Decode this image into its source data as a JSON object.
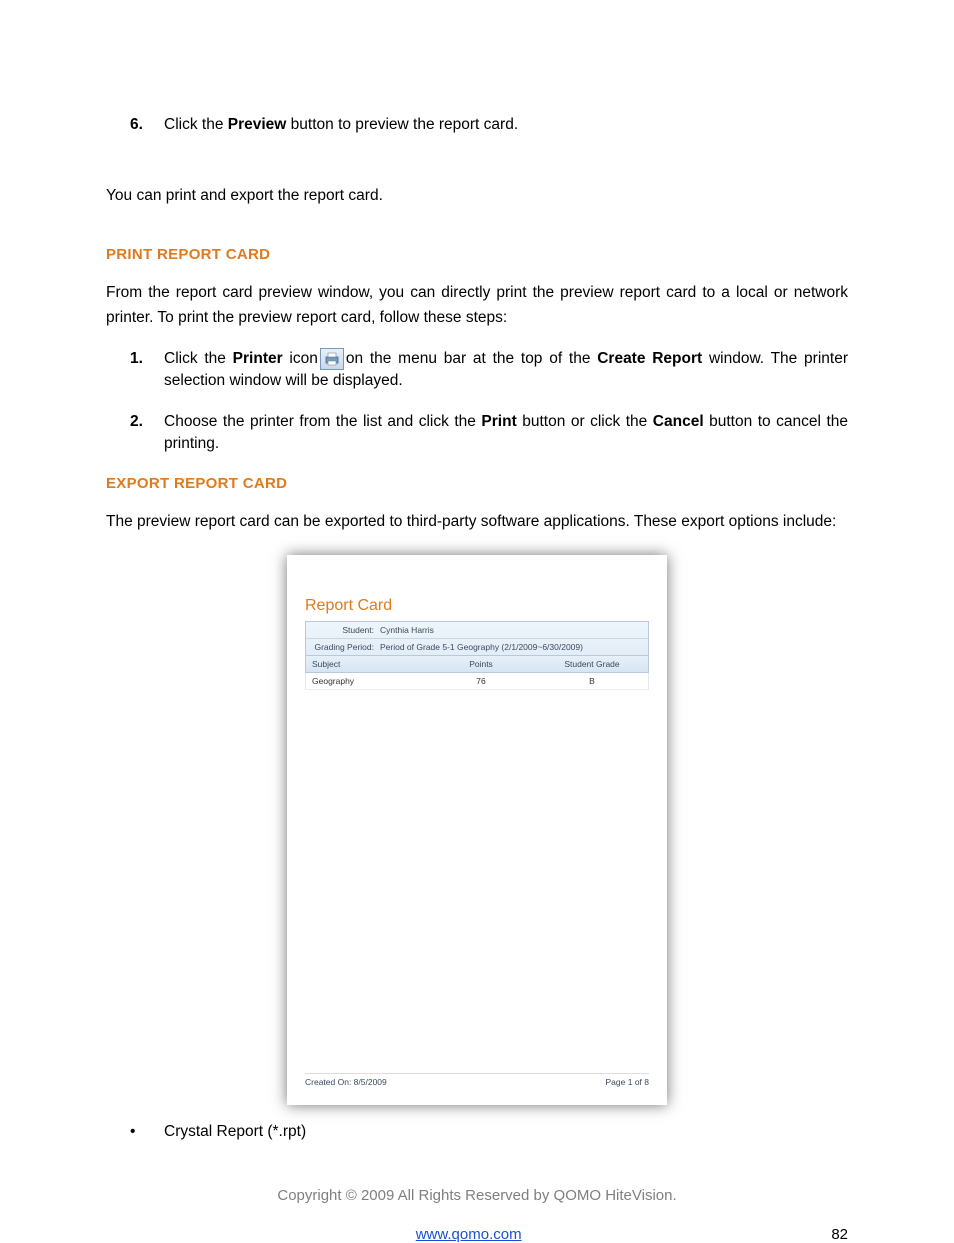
{
  "step6": {
    "num": "6.",
    "text_pre": "Click the ",
    "bold1": "Preview",
    "text_post": " button to preview the report card."
  },
  "intro_after": "You can print and export the report card.",
  "print_heading": "PRINT REPORT CARD",
  "print_intro": "From the report card preview window, you can directly print the preview report card to a local or network printer. To print the preview report card, follow these steps:",
  "print_step1": {
    "num": "1.",
    "t1": "Click the ",
    "b1": "Printer",
    "t2": " icon",
    "t3": "on the menu bar at the top of the ",
    "b2": "Create Report",
    "t4": " window. The printer selection window will be displayed."
  },
  "print_step2": {
    "num": "2.",
    "t1": "Choose the printer from the list and click the ",
    "b1": "Print",
    "t2": " button or click the ",
    "b2": "Cancel",
    "t3": " button to cancel the printing."
  },
  "export_heading": "EXPORT REPORT CARD",
  "export_intro": "The preview report card can be exported to third-party software applications. These export options include:",
  "report_card": {
    "title": "Report Card",
    "student_label": "Student:",
    "student_value": "Cynthia Harris",
    "period_label": "Grading Period:",
    "period_value": "Period  of Grade 5-1 Geography (2/1/2009~6/30/2009)",
    "col_subject": "Subject",
    "col_points": "Points",
    "col_grade": "Student Grade",
    "row_subject": "Geography",
    "row_points": "76",
    "row_grade": "B",
    "created": "Created On:  8/5/2009",
    "page": "Page 1 of 8"
  },
  "bullet1": "Crystal Report (*.rpt)",
  "copyright": "Copyright © 2009 All Rights Reserved by QOMO HiteVision.",
  "footer_link": "www.qomo.com",
  "footer_page": "82"
}
